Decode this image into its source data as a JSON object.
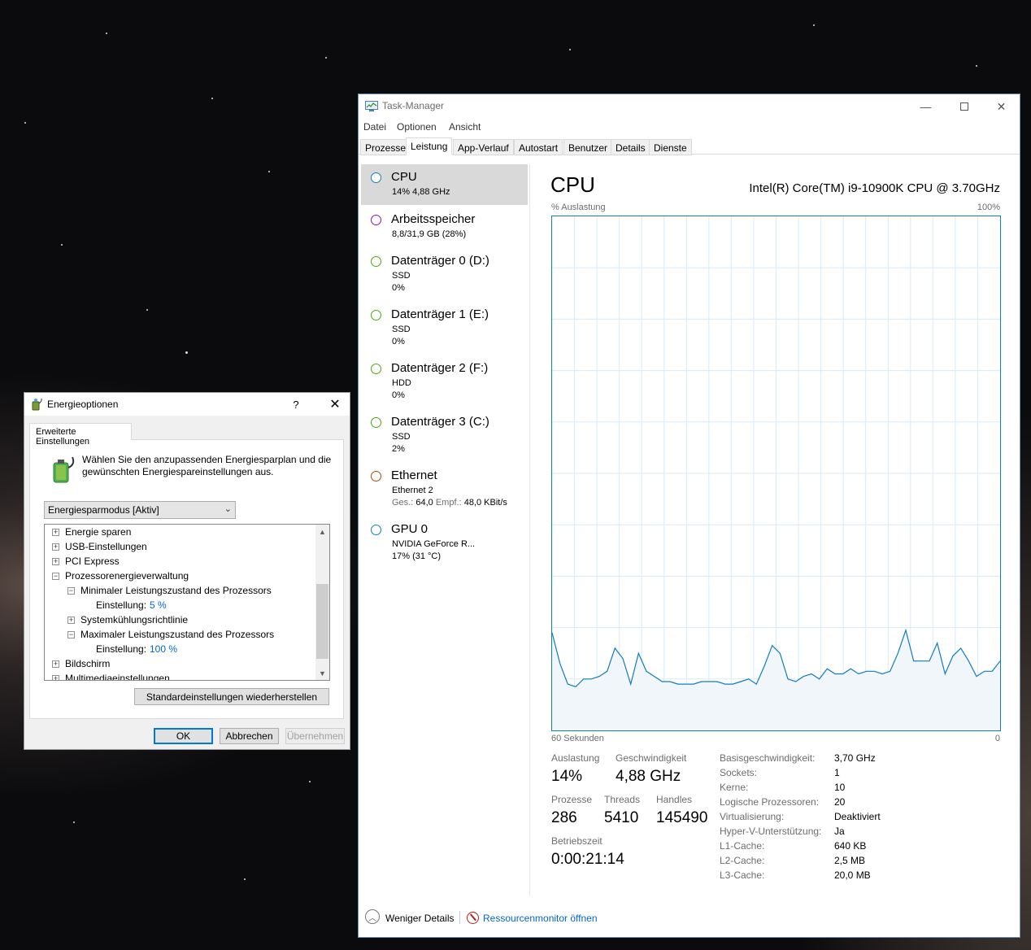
{
  "task_manager": {
    "title": "Task-Manager",
    "menu": [
      "Datei",
      "Optionen",
      "Ansicht"
    ],
    "tabs": [
      "Prozesse",
      "Leistung",
      "App-Verlauf",
      "Autostart",
      "Benutzer",
      "Details",
      "Dienste"
    ],
    "active_tab": "Leistung",
    "sidebar": [
      {
        "title": "CPU",
        "line1": "14% 4,88 GHz",
        "line2": "",
        "color": "#117dbb",
        "selected": true
      },
      {
        "title": "Arbeitsspeicher",
        "line1": "8,8/31,9 GB (28%)",
        "line2": "",
        "color": "#8b12ae"
      },
      {
        "title": "Datenträger 0 (D:)",
        "line1": "SSD",
        "line2": "0%",
        "color": "#4da60c"
      },
      {
        "title": "Datenträger 1 (E:)",
        "line1": "SSD",
        "line2": "0%",
        "color": "#4da60c"
      },
      {
        "title": "Datenträger 2 (F:)",
        "line1": "HDD",
        "line2": "0%",
        "color": "#4da60c"
      },
      {
        "title": "Datenträger 3 (C:)",
        "line1": "SSD",
        "line2": "2%",
        "color": "#4da60c"
      },
      {
        "title": "Ethernet",
        "line1": "Ethernet 2",
        "send_label": "Ges.:",
        "send_value": "64,0",
        "recv_label": "Empf.:",
        "recv_value": "48,0 KBit/s",
        "color": "#a74f01"
      },
      {
        "title": "GPU 0",
        "line1": "NVIDIA GeForce R...",
        "line2": "17% (31 °C)",
        "color": "#117dbb"
      }
    ],
    "main": {
      "title": "CPU",
      "model": "Intel(R) Core(TM) i9-10900K CPU @ 3.70GHz",
      "graph_label_top_left": "% Auslastung",
      "graph_label_top_right": "100%",
      "graph_label_bottom_left": "60 Sekunden",
      "graph_label_bottom_right": "0",
      "stats": {
        "utilization_label": "Auslastung",
        "utilization": "14%",
        "speed_label": "Geschwindigkeit",
        "speed": "4,88 GHz",
        "processes_label": "Prozesse",
        "processes": "286",
        "threads_label": "Threads",
        "threads": "5410",
        "handles_label": "Handles",
        "handles": "145490",
        "uptime_label": "Betriebszeit",
        "uptime": "0:00:21:14"
      },
      "info": [
        {
          "label": "Basisgeschwindigkeit:",
          "value": "3,70 GHz"
        },
        {
          "label": "Sockets:",
          "value": "1"
        },
        {
          "label": "Kerne:",
          "value": "10"
        },
        {
          "label": "Logische Prozessoren:",
          "value": "20"
        },
        {
          "label": "Virtualisierung:",
          "value": "Deaktiviert"
        },
        {
          "label": "Hyper-V-Unterstützung:",
          "value": "Ja"
        },
        {
          "label": "L1-Cache:",
          "value": "640 KB"
        },
        {
          "label": "L2-Cache:",
          "value": "2,5 MB"
        },
        {
          "label": "L3-Cache:",
          "value": "20,0 MB"
        }
      ]
    },
    "footer": {
      "less_details": "Weniger Details",
      "resource_monitor": "Ressourcenmonitor öffnen"
    }
  },
  "chart_data": {
    "type": "area",
    "xlabel": "60 Sekunden",
    "ylabel": "% Auslastung",
    "ylim": [
      0,
      100
    ],
    "xlim": [
      60,
      0
    ],
    "grid": true,
    "color": "#117dbb",
    "x": [
      60,
      59,
      58,
      57,
      56,
      55,
      54,
      53,
      52,
      51,
      50,
      49,
      48,
      47,
      46,
      45,
      44,
      43,
      42,
      41,
      40,
      39,
      38,
      37,
      36,
      35,
      34,
      33,
      32,
      31,
      30,
      29,
      28,
      27,
      26,
      25,
      24,
      23,
      22,
      21,
      20,
      19,
      18,
      17,
      16,
      15,
      14,
      13,
      12,
      11,
      10,
      9,
      8,
      7,
      6,
      5,
      4,
      3,
      2,
      1,
      0
    ],
    "series": [
      {
        "values": [
          19,
          13,
          9,
          8.5,
          10,
          10,
          10.5,
          11.5,
          16,
          14,
          9,
          15,
          11.5,
          10.5,
          9.5,
          9.5,
          9,
          9,
          9,
          9.5,
          9.5,
          9.5,
          9,
          9,
          9.5,
          10,
          9,
          12.5,
          16.5,
          15,
          10,
          9.5,
          10.5,
          11,
          10,
          12,
          11,
          11,
          12,
          11,
          11.5,
          11.5,
          11,
          11.5,
          15,
          19.5,
          13.5,
          13.5,
          13.5,
          17,
          11,
          14.5,
          16,
          13.5,
          10.5,
          11.5,
          11.5,
          13.5
        ]
      }
    ]
  },
  "power_options": {
    "title": "Energieoptionen",
    "help": "?",
    "close": "✕",
    "tab": "Erweiterte Einstellungen",
    "description": "Wählen Sie den anzupassenden Energiesparplan und die gewünschten Energiespareinstellungen aus.",
    "plan": "Energiesparmodus [Aktiv]",
    "tree": [
      {
        "text": "Energie sparen",
        "toggle": "+",
        "level": 0
      },
      {
        "text": "USB-Einstellungen",
        "toggle": "+",
        "level": 0
      },
      {
        "text": "PCI Express",
        "toggle": "+",
        "level": 0
      },
      {
        "text": "Prozessorenergieverwaltung",
        "toggle": "−",
        "level": 0
      },
      {
        "text": "Minimaler Leistungszustand des Prozessors",
        "toggle": "−",
        "level": 1
      },
      {
        "text": "Einstellung:",
        "value": "5 %",
        "level": 2
      },
      {
        "text": "Systemkühlungsrichtlinie",
        "toggle": "+",
        "level": 1
      },
      {
        "text": "Maximaler Leistungszustand des Prozessors",
        "toggle": "−",
        "level": 1
      },
      {
        "text": "Einstellung:",
        "value": "100 %",
        "level": 2
      },
      {
        "text": "Bildschirm",
        "toggle": "+",
        "level": 0
      },
      {
        "text": "Multimediaeinstellungen",
        "toggle": "+",
        "level": 0
      }
    ],
    "restore_button": "Standardeinstellungen wiederherstellen",
    "ok": "OK",
    "cancel": "Abbrechen",
    "apply": "Übernehmen"
  }
}
